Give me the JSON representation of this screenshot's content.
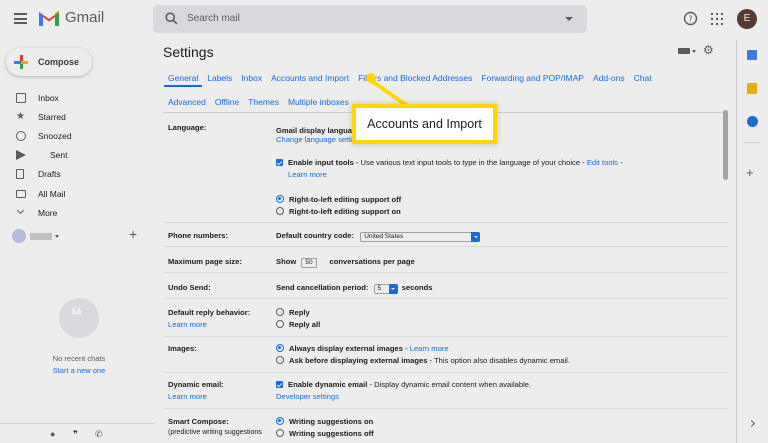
{
  "header": {
    "app_name": "Gmail",
    "search_placeholder": "Search mail",
    "avatar_letter": "E"
  },
  "sidebar": {
    "compose": "Compose",
    "items": [
      {
        "label": "Inbox",
        "icon": "inbox-icon"
      },
      {
        "label": "Starred",
        "icon": "star-icon"
      },
      {
        "label": "Snoozed",
        "icon": "clock-icon"
      },
      {
        "label": "Sent",
        "icon": "send-icon"
      },
      {
        "label": "Drafts",
        "icon": "draft-icon"
      },
      {
        "label": "All Mail",
        "icon": "mail-icon"
      },
      {
        "label": "More",
        "icon": "chevron-down-icon"
      }
    ],
    "no_chats": "No recent chats",
    "start_new": "Start a new one"
  },
  "settings": {
    "title": "Settings",
    "tabs_row1": [
      "General",
      "Labels",
      "Inbox",
      "Accounts and Import",
      "Filters and Blocked Addresses",
      "Forwarding and POP/IMAP",
      "Add-ons",
      "Chat"
    ],
    "tabs_row2": [
      "Advanced",
      "Offline",
      "Themes",
      "Multiple inboxes"
    ],
    "rows": {
      "language": {
        "label": "Language:",
        "display_lang": "Gmail display language:",
        "change_lang": "Change language settings",
        "enable_input_bold": "Enable input tools",
        "enable_input_text": " - Use various text input tools to type in the language of your choice - ",
        "edit_tools": "Edit tools",
        "edit_tools_dash": " -",
        "learn_more": "Learn more",
        "rtl_off": "Right-to-left editing support off",
        "rtl_on": "Right-to-left editing support on"
      },
      "phone": {
        "label": "Phone numbers:",
        "text": "Default country code:",
        "value": "United States"
      },
      "page_size": {
        "label": "Maximum page size:",
        "show": "Show",
        "value": "50",
        "suffix": "conversations per page"
      },
      "undo_send": {
        "label": "Undo Send:",
        "text": "Send cancellation period:",
        "value": "5",
        "suffix": "seconds"
      },
      "reply": {
        "label": "Default reply behavior:",
        "learn_more": "Learn more",
        "opt1": "Reply",
        "opt2": "Reply all"
      },
      "images": {
        "label": "Images:",
        "opt1": "Always display external images",
        "opt1_link": "Learn more",
        "opt2": "Ask before displaying external images",
        "opt2_suffix": " - This option also disables dynamic email."
      },
      "dynamic": {
        "label": "Dynamic email:",
        "learn_more": "Learn more",
        "bold": "Enable dynamic email",
        "text": " - Display dynamic email content when available.",
        "dev": "Developer settings"
      },
      "smart": {
        "label": "Smart Compose:",
        "sub": "(predictive writing suggestions",
        "opt1": "Writing suggestions on",
        "opt2": "Writing suggestions off"
      }
    }
  },
  "callout": {
    "text": "Accounts and Import"
  },
  "colors": {
    "accent": "#1a73e8",
    "highlight": "#ffd700"
  }
}
